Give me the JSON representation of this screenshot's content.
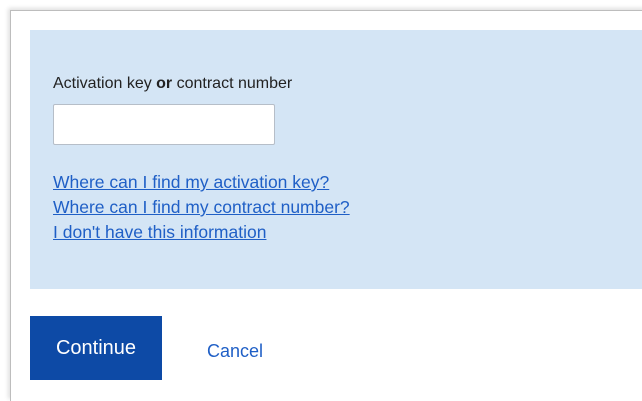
{
  "form": {
    "label_part1": "Activation key ",
    "label_or": "or",
    "label_part2": " contract number",
    "input_value": "",
    "links": [
      "Where can I find my activation key?",
      "Where can I find my contract number?",
      "I don't have this information"
    ]
  },
  "actions": {
    "continue_label": "Continue",
    "cancel_label": "Cancel"
  },
  "colors": {
    "panel_background": "#d4e5f5",
    "link": "#1f5fc6",
    "primary_button": "#0d4aa6"
  }
}
